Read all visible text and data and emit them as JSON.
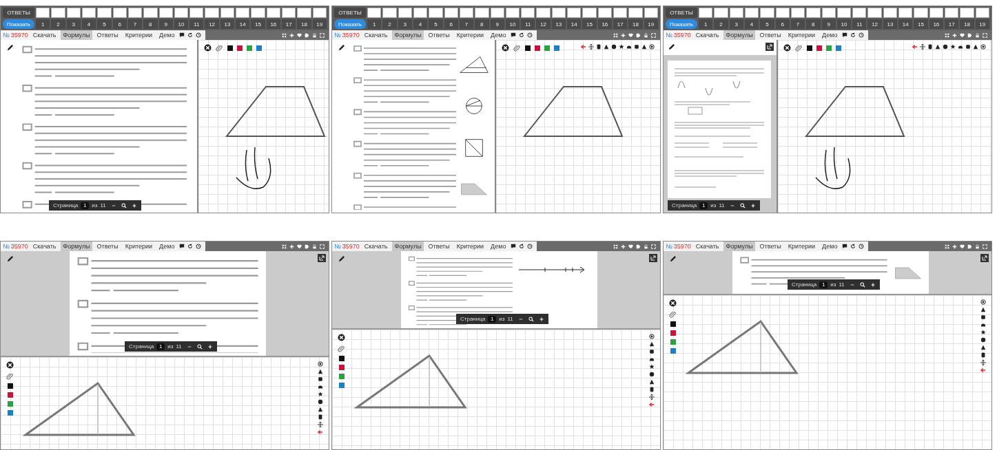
{
  "screens": [
    {
      "kind": "side",
      "answers_bar": {
        "toggle": "ОТВЕТЫ",
        "show": "Показать",
        "numbers": [
          "1",
          "2",
          "3",
          "4",
          "5",
          "6",
          "7",
          "8",
          "9",
          "10",
          "11",
          "12",
          "13",
          "14",
          "15",
          "16",
          "17",
          "18",
          "19"
        ]
      },
      "number_prefix": "№",
      "number": "35970",
      "tabs": [
        {
          "label": "Скачать",
          "selected": false
        },
        {
          "label": "Формулы",
          "selected": true
        },
        {
          "label": "Ответы",
          "selected": false
        },
        {
          "label": "Критерии",
          "selected": false
        },
        {
          "label": "Демо",
          "selected": false
        }
      ],
      "doc": {
        "kind": "page"
      },
      "pager": {
        "label": "Страница",
        "page": "1",
        "of": "из",
        "total": "11"
      },
      "canvas": {
        "shape": {
          "kind": "trapezoid"
        },
        "scribble": true,
        "colors": [
          {
            "color": "#111111"
          },
          {
            "color": "#c8143c"
          },
          {
            "color": "#2ea043"
          },
          {
            "color": "#1f7fc4"
          }
        ]
      }
    },
    {
      "kind": "side",
      "answers_bar": {
        "toggle": "ОТВЕТЫ",
        "show": "Показать",
        "numbers": [
          "1",
          "2",
          "3",
          "4",
          "5",
          "6",
          "7",
          "8",
          "9",
          "10",
          "11",
          "12",
          "13",
          "14",
          "15",
          "16",
          "17",
          "18",
          "19"
        ]
      },
      "number_prefix": "№",
      "number": "35970",
      "tabs": [
        {
          "label": "Скачать",
          "selected": false
        },
        {
          "label": "Формулы",
          "selected": true
        },
        {
          "label": "Ответы",
          "selected": false
        },
        {
          "label": "Критерии",
          "selected": false
        },
        {
          "label": "Демо",
          "selected": false
        }
      ],
      "doc": {
        "kind": "page",
        "figures": [
          {
            "kind": "triangle"
          },
          {
            "kind": "circle"
          },
          {
            "kind": "square"
          },
          {
            "kind": "trapezoid"
          }
        ]
      },
      "canvas": {
        "shape": {
          "kind": "trapezoid"
        },
        "shape_toolbar": true,
        "colors": [
          {
            "color": "#111111"
          },
          {
            "color": "#c8143c"
          },
          {
            "color": "#2ea043"
          },
          {
            "color": "#1f7fc4"
          }
        ]
      }
    },
    {
      "kind": "side",
      "answers_bar": {
        "toggle": "ОТВЕТЫ",
        "show": "Показать",
        "numbers": [
          "1",
          "2",
          "3",
          "4",
          "5",
          "6",
          "7",
          "8",
          "9",
          "10",
          "11",
          "12",
          "13",
          "14",
          "15",
          "16",
          "17",
          "18",
          "19"
        ]
      },
      "number_prefix": "№",
      "number": "35970",
      "tabs": [
        {
          "label": "Скачать",
          "selected": false
        },
        {
          "label": "Формулы",
          "selected": true
        },
        {
          "label": "Ответы",
          "selected": false
        },
        {
          "label": "Критерии",
          "selected": false
        },
        {
          "label": "Демо",
          "selected": false
        }
      ],
      "doc": {
        "kind": "thumbnail",
        "expand": true
      },
      "pager": {
        "label": "Страница",
        "page": "1",
        "of": "из",
        "total": "11"
      },
      "canvas": {
        "shape": {
          "kind": "trapezoid"
        },
        "scribble": true,
        "shape_toolbar": true,
        "colors": [
          {
            "color": "#111111"
          },
          {
            "color": "#c8143c"
          },
          {
            "color": "#2ea043"
          },
          {
            "color": "#1f7fc4"
          }
        ]
      }
    },
    {
      "kind": "stack",
      "number_prefix": "№",
      "number": "35970",
      "tabs": [
        {
          "label": "Скачать",
          "selected": false
        },
        {
          "label": "Формулы",
          "selected": true
        },
        {
          "label": "Ответы",
          "selected": false
        },
        {
          "label": "Критерии",
          "selected": false
        },
        {
          "label": "Демо",
          "selected": false
        }
      ],
      "doc": {
        "kind": "page",
        "expand": true
      },
      "pager": {
        "label": "Страница",
        "page": "1",
        "of": "из",
        "total": "11"
      },
      "canvas": {
        "shape": {
          "kind": "triangle"
        },
        "shape_toolbar": true,
        "colors": [
          {
            "color": "#111111"
          },
          {
            "color": "#c8143c"
          },
          {
            "color": "#2ea043"
          },
          {
            "color": "#1f7fc4"
          }
        ]
      }
    },
    {
      "kind": "stack",
      "number_prefix": "№",
      "number": "35970",
      "tabs": [
        {
          "label": "Скачать",
          "selected": false
        },
        {
          "label": "Формулы",
          "selected": true
        },
        {
          "label": "Ответы",
          "selected": false
        },
        {
          "label": "Критерии",
          "selected": false
        },
        {
          "label": "Демо",
          "selected": false
        }
      ],
      "doc": {
        "kind": "page",
        "expand": true,
        "figures": [
          {
            "kind": "numberline"
          }
        ]
      },
      "pager": {
        "label": "Страница",
        "page": "1",
        "of": "из",
        "total": "11"
      },
      "canvas": {
        "shape": {
          "kind": "triangle"
        },
        "shape_toolbar": true,
        "colors": [
          {
            "color": "#111111"
          },
          {
            "color": "#c8143c"
          },
          {
            "color": "#2ea043"
          },
          {
            "color": "#1f7fc4"
          }
        ]
      }
    },
    {
      "kind": "stack",
      "number_prefix": "№",
      "number": "35970",
      "tabs": [
        {
          "label": "Скачать",
          "selected": false
        },
        {
          "label": "Формулы",
          "selected": true
        },
        {
          "label": "Ответы",
          "selected": false
        },
        {
          "label": "Критерии",
          "selected": false
        },
        {
          "label": "Демо",
          "selected": false
        }
      ],
      "doc": {
        "kind": "page",
        "expand": true,
        "figures": [
          {
            "kind": "trapezoid"
          }
        ]
      },
      "pager": {
        "label": "Страница",
        "page": "1",
        "of": "из",
        "total": "11"
      },
      "canvas": {
        "shape": {
          "kind": "triangle"
        },
        "shape_toolbar": true,
        "colors": [
          {
            "color": "#111111"
          },
          {
            "color": "#c8143c"
          },
          {
            "color": "#2ea043"
          },
          {
            "color": "#1f7fc4"
          }
        ]
      }
    }
  ]
}
